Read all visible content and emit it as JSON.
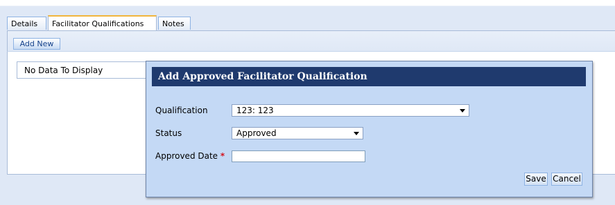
{
  "tabs": [
    {
      "label": "Details"
    },
    {
      "label": "Facilitator Qualifications",
      "active": true
    },
    {
      "label": "Notes"
    }
  ],
  "toolbar": {
    "add_new_label": "Add New"
  },
  "grid": {
    "empty_text": "No Data To Display"
  },
  "dialog": {
    "title": "Add Approved Facilitator Qualification",
    "fields": {
      "qualification": {
        "label": "Qualification",
        "value": "123: 123"
      },
      "status": {
        "label": "Status",
        "value": "Approved"
      },
      "approved_date": {
        "label": "Approved Date",
        "required_marker": "*",
        "value": ""
      }
    },
    "buttons": {
      "save": "Save",
      "cancel": "Cancel"
    }
  },
  "colors": {
    "dialog_header_bg": "#1f3a6e",
    "dialog_bg": "#c4d9f5",
    "active_tab_accent": "#f2b53c",
    "required_marker": "#d4141f"
  },
  "icons": {
    "dropdown": "chevron-down-icon"
  }
}
